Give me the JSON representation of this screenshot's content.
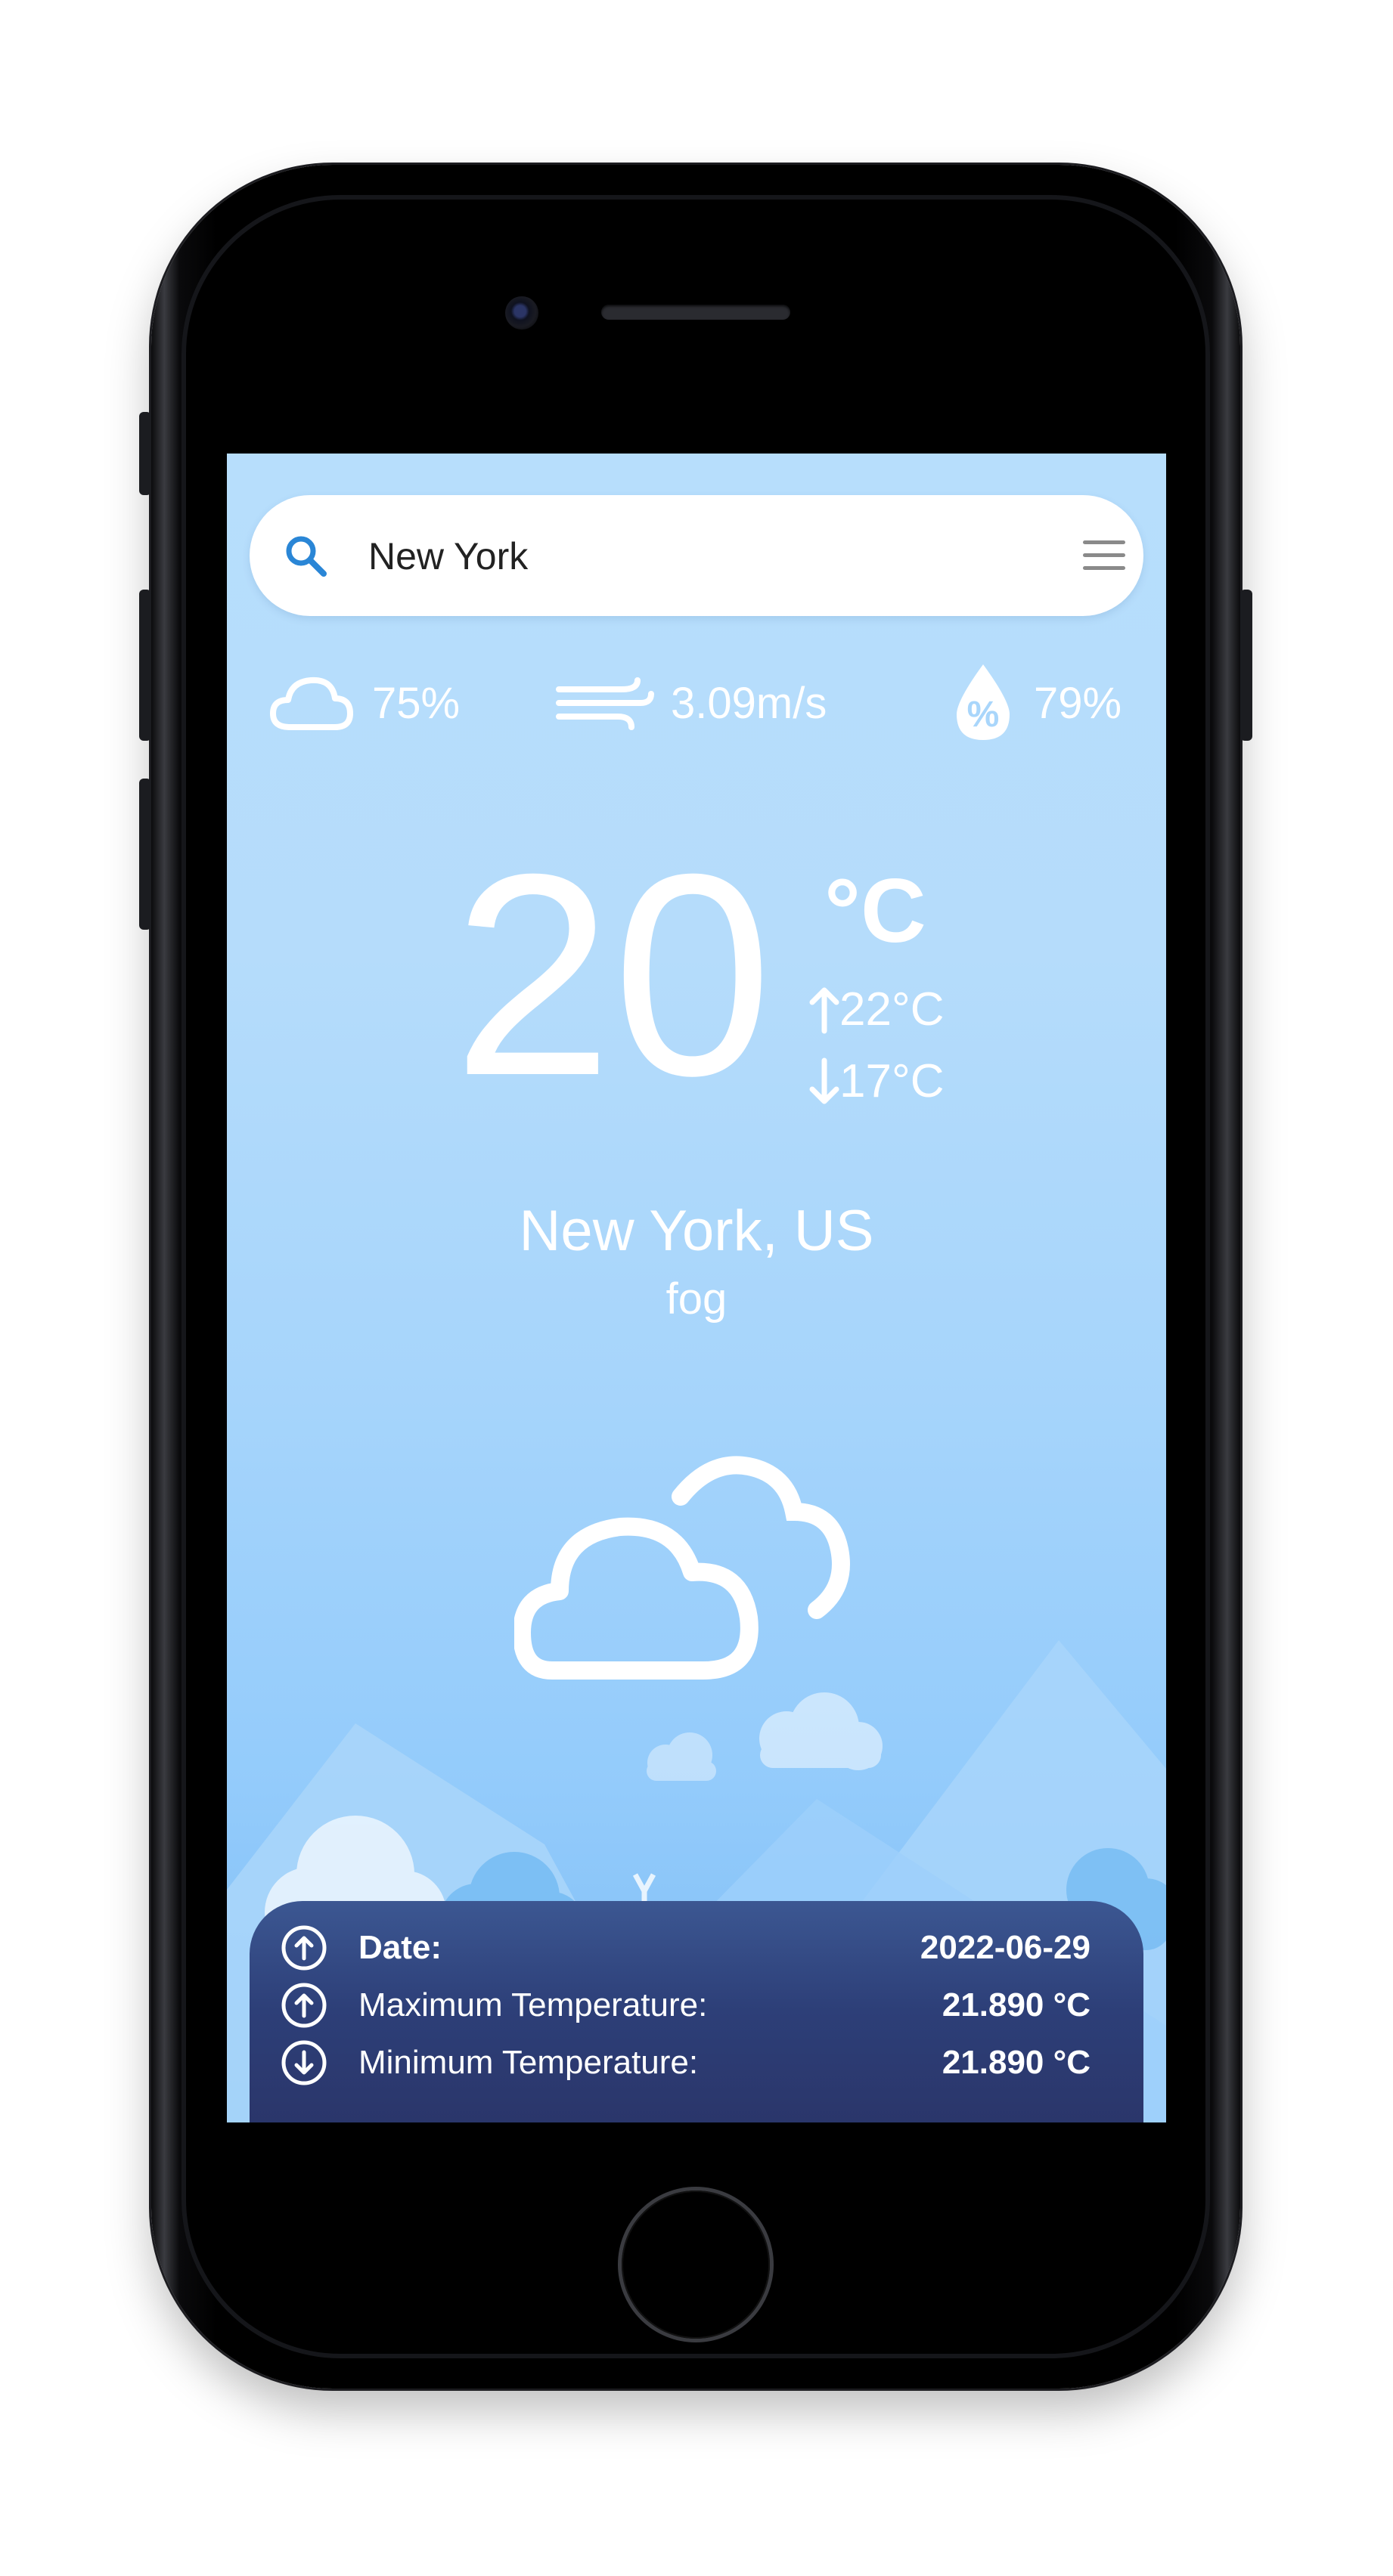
{
  "search": {
    "value": "New York"
  },
  "stats": {
    "cloudiness": "75%",
    "wind_speed": "3.09m/s",
    "humidity": "79%"
  },
  "current": {
    "temperature": "20",
    "unit": "°C",
    "max": "22°C",
    "min": "17°C",
    "location": "New York, US",
    "description": "fog"
  },
  "details": [
    {
      "label": "Date:",
      "value": "2022-06-29"
    },
    {
      "label": "Maximum Temperature:",
      "value": "21.890 °C"
    },
    {
      "label": "Minimum Temperature:",
      "value": "21.890 °C"
    }
  ],
  "colors": {
    "sky_top": "#b7defc",
    "sky_bottom": "#7dbcf4",
    "panel": "#2d3f78",
    "search_accent": "#2a86d6"
  },
  "icons": {
    "search": "search-icon",
    "menu": "menu-icon",
    "cloudiness": "cloud-icon",
    "wind": "wind-icon",
    "humidity": "humidity-drop-icon",
    "weather": "partly-cloudy-icon",
    "date": "arrow-up-circle-icon",
    "max": "arrow-up-circle-icon",
    "min": "arrow-down-circle-icon"
  }
}
